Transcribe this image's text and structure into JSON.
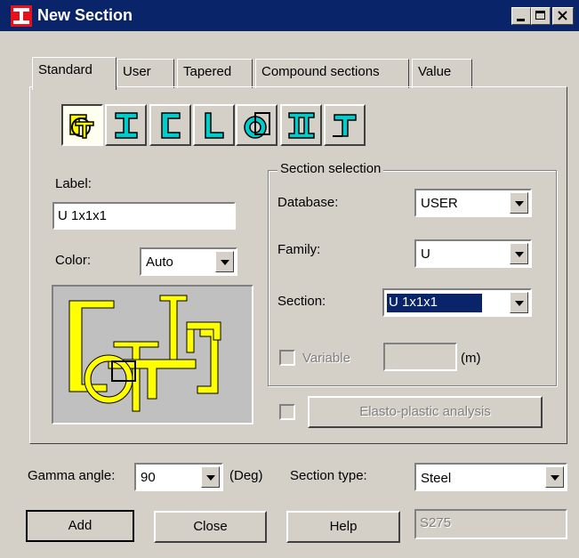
{
  "window": {
    "title": "New Section"
  },
  "tabs": [
    "Standard",
    "User",
    "Tapered",
    "Compound sections",
    "Value"
  ],
  "section_type_icons": [
    "compound-section-icon",
    "i-beam-icon",
    "channel-section-icon",
    "angle-section-icon",
    "tube-section-icon",
    "double-i-section-icon",
    "tee-section-icon"
  ],
  "label": {
    "caption": "Label:",
    "value": "U 1x1x1"
  },
  "color": {
    "caption": "Color:",
    "value": "Auto"
  },
  "section_selection": {
    "title": "Section selection",
    "database_label": "Database:",
    "database_value": "USER",
    "family_label": "Family:",
    "family_value": "U",
    "section_label": "Section:",
    "section_value": "U 1x1x1",
    "variable_label": "Variable",
    "variable_unit": "(m)"
  },
  "elasto_plastic_label": "Elasto-plastic analysis",
  "gamma": {
    "label": "Gamma angle:",
    "value": "90",
    "unit": "(Deg)"
  },
  "section_type": {
    "label": "Section type:",
    "value": "Steel"
  },
  "buttons": {
    "add": "Add",
    "close": "Close",
    "help": "Help"
  },
  "material": "S275",
  "colors": {
    "title_bar": "#0a246a",
    "preview_bg": "#c0c0c0",
    "shape_fill": "#ffff00",
    "icon_accent": "#00c8c8",
    "selection": "#0a246a"
  }
}
